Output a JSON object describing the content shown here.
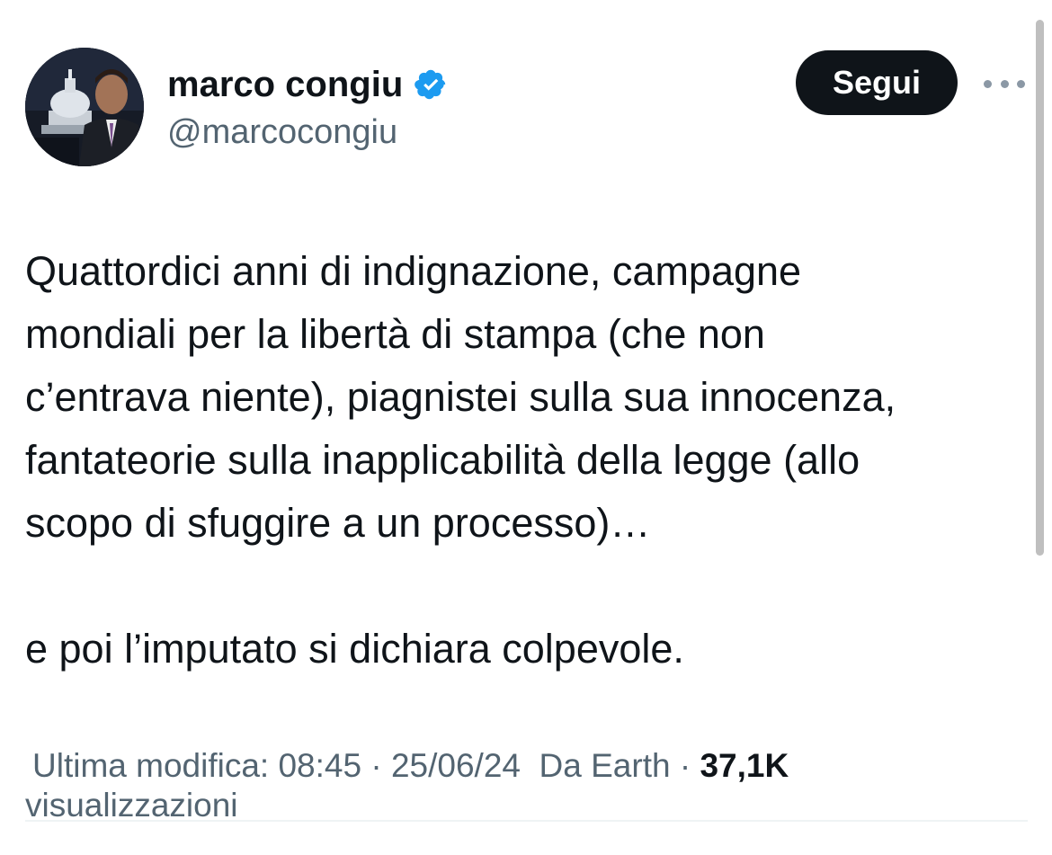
{
  "author": {
    "display_name": "marco congiu",
    "handle": "@marcocongiu",
    "verified_icon": "verified-badge-icon",
    "avatar": "profile-photo"
  },
  "actions": {
    "follow_label": "Segui",
    "more_icon": "more-options-icon"
  },
  "tweet": {
    "paragraph_1": "Quattordici anni di indignazione, campagne\nmondiali per la libertà di stampa (che non\nc’entrava niente), piagnistei sulla sua innocenza,\nfantateorie sulla inapplicabilità della legge (allo\nscopo di sfuggire a un processo)…",
    "paragraph_2": "e poi l’imputato si dichiara colpevole."
  },
  "meta": {
    "edited_label": "Ultima modifica:",
    "time": "08:45",
    "date": "25/06/24",
    "source": "Da Earth",
    "separator": "·",
    "views_count": "37,1K",
    "views_label": "visualizzazioni"
  },
  "colors": {
    "text": "#0f1419",
    "secondary": "#536471",
    "verified": "#1d9bf0",
    "button_bg": "#0f1419"
  }
}
